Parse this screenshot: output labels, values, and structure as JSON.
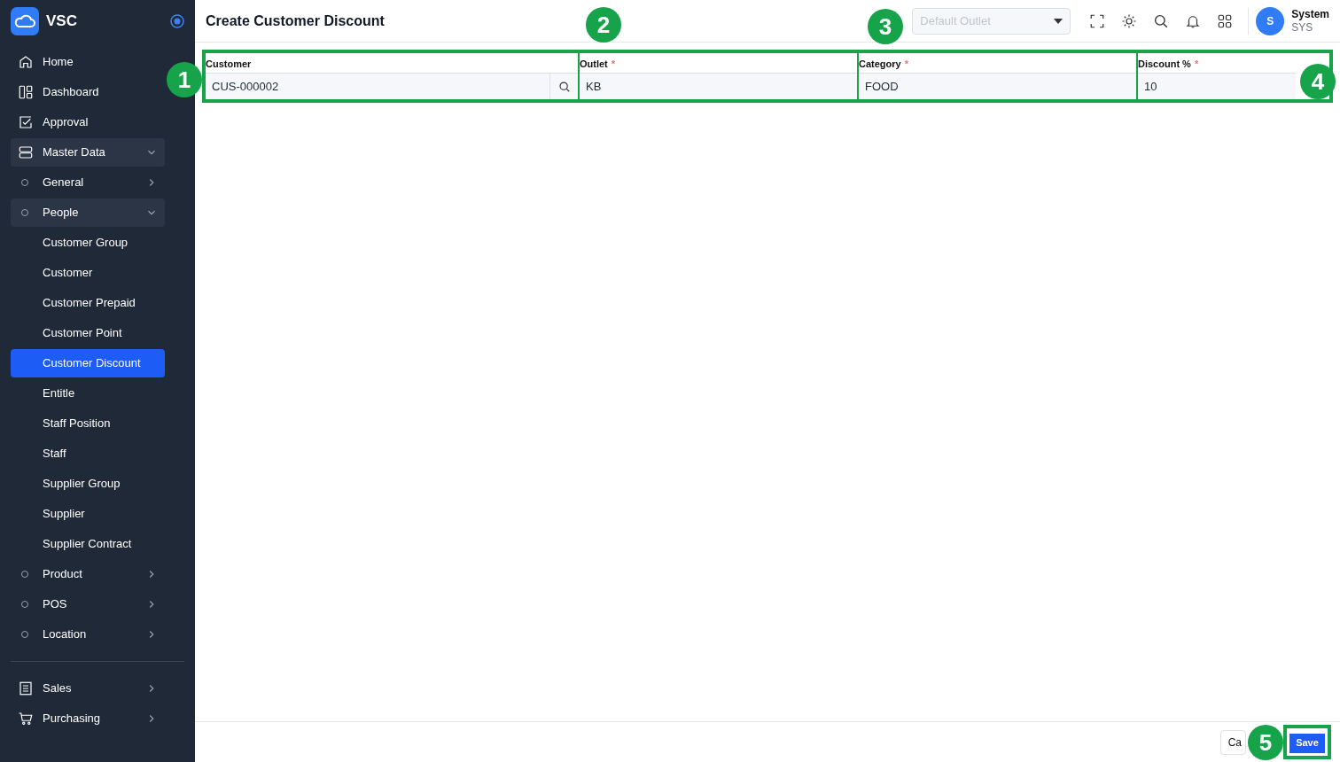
{
  "sidebar": {
    "brand": "VSC",
    "sections": [
      [
        {
          "label": "Home",
          "selected": false
        },
        {
          "label": "Dashboard",
          "selected": false
        },
        {
          "label": "Approval",
          "selected": false
        },
        {
          "label": "Master Data",
          "selected": false,
          "expanded": true,
          "children": [
            {
              "label": "General",
              "selected": false,
              "expanded": false
            },
            {
              "label": "People",
              "selected": false,
              "expanded": true,
              "children": [
                {
                  "label": "Customer Group",
                  "selected": false
                },
                {
                  "label": "Customer",
                  "selected": false
                },
                {
                  "label": "Customer Prepaid",
                  "selected": false
                },
                {
                  "label": "Customer Point",
                  "selected": false
                },
                {
                  "label": "Customer Discount",
                  "selected": true
                },
                {
                  "label": "Entitle",
                  "selected": false
                },
                {
                  "label": "Staff Position",
                  "selected": false
                },
                {
                  "label": "Staff",
                  "selected": false
                },
                {
                  "label": "Supplier Group",
                  "selected": false
                },
                {
                  "label": "Supplier",
                  "selected": false
                },
                {
                  "label": "Supplier Contract",
                  "selected": false
                }
              ]
            },
            {
              "label": "Product",
              "selected": false,
              "expanded": false
            },
            {
              "label": "POS",
              "selected": false,
              "expanded": false
            },
            {
              "label": "Location",
              "selected": false,
              "expanded": false
            }
          ]
        }
      ],
      [
        {
          "label": "Sales",
          "selected": false,
          "expanded": false
        },
        {
          "label": "Purchasing",
          "selected": false,
          "expanded": false
        }
      ]
    ]
  },
  "header": {
    "title": "Create Customer Discount",
    "outlet_select": {
      "placeholder": "Default Outlet"
    },
    "user": {
      "initial": "S",
      "name": "System",
      "code": "SYS"
    }
  },
  "form": {
    "fields": [
      {
        "kind": "lookup",
        "label": "Customer",
        "value": "CUS-000002"
      },
      {
        "kind": "text",
        "label": "Outlet",
        "required_mark": "*",
        "value": "KB"
      },
      {
        "kind": "text",
        "label": "Category",
        "required_mark": "*",
        "value": "FOOD"
      },
      {
        "kind": "text",
        "label": "Discount %",
        "required_mark": "*",
        "value": "10"
      }
    ]
  },
  "footer": {
    "cancel": "Ca",
    "save": "Save"
  },
  "annotations": [
    {
      "number": "1"
    },
    {
      "number": "2"
    },
    {
      "number": "3"
    },
    {
      "number": "4"
    },
    {
      "number": "5"
    }
  ]
}
